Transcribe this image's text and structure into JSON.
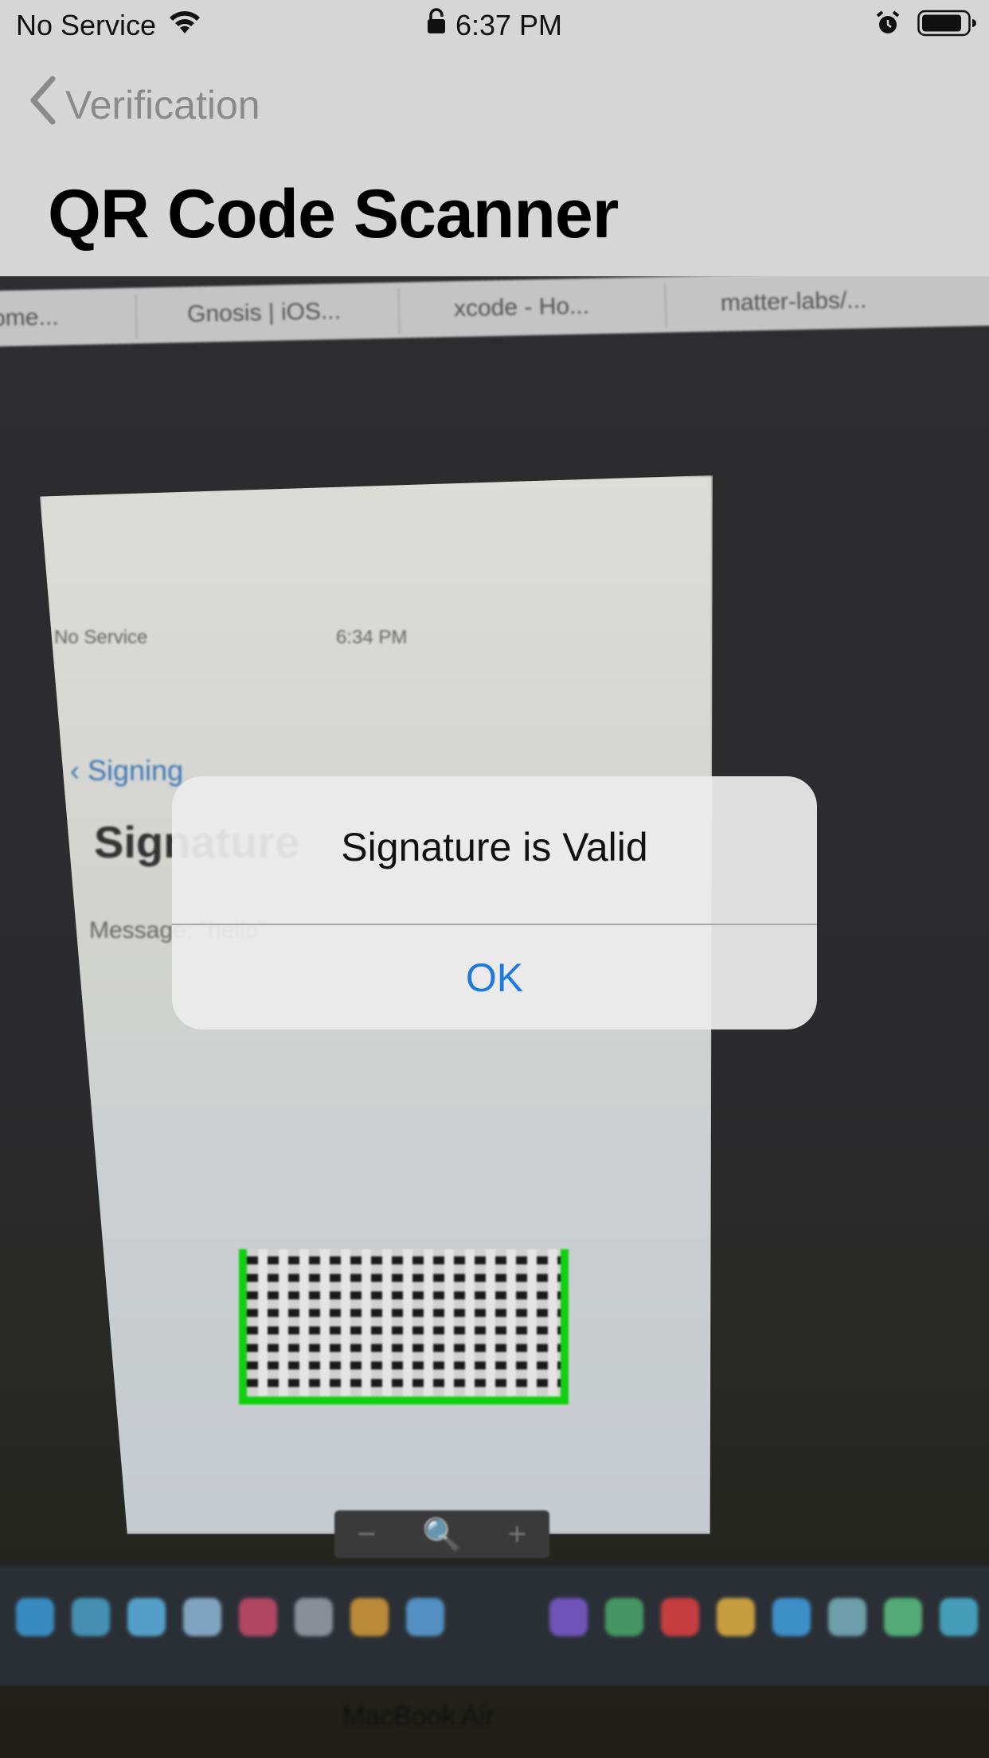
{
  "status_bar": {
    "carrier": "No Service",
    "time": "6:37 PM"
  },
  "nav": {
    "back_label": "Verification",
    "title": "QR Code Scanner"
  },
  "camera_preview": {
    "tabs": [
      "ome...",
      "Gnosis | iOS...",
      "xcode - Ho...",
      "matter-labs/..."
    ],
    "phone": {
      "carrier": "No Service",
      "time": "6:34 PM",
      "back_label": "Signing",
      "title": "Signature",
      "message": "Message: \"hello\""
    },
    "zoom_controls": [
      "−",
      "🔍",
      "+"
    ],
    "laptop_label": "MacBook Air"
  },
  "alert": {
    "title": "Signature is Valid",
    "ok_label": "OK"
  },
  "colors": {
    "tint": "#1f7ae0",
    "qr_highlight": "#10d00f"
  }
}
